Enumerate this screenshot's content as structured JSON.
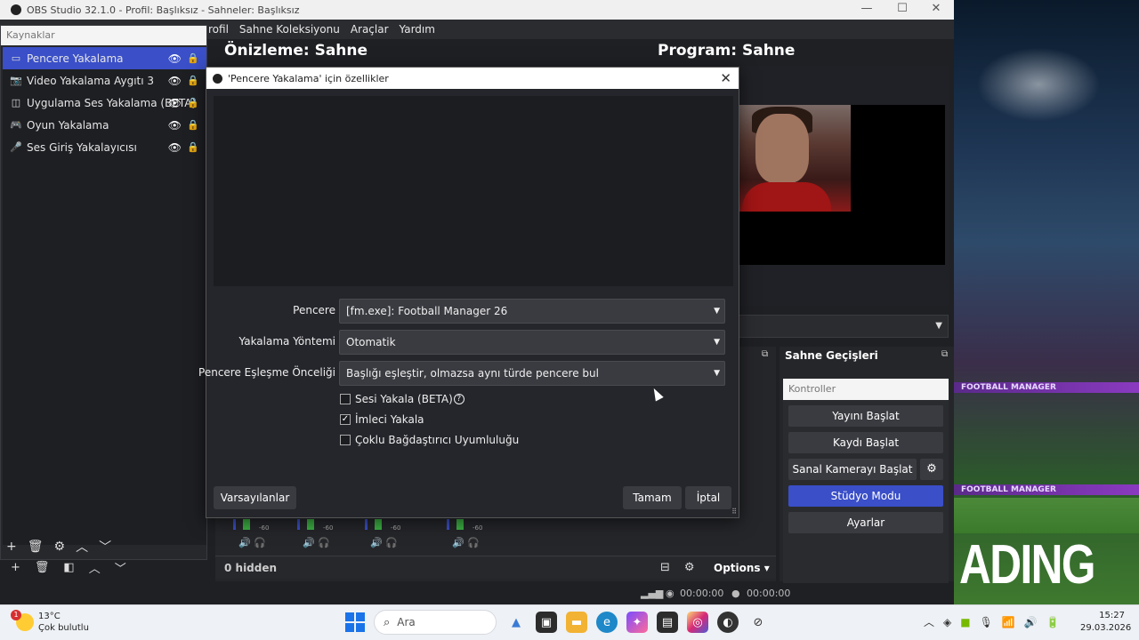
{
  "window": {
    "title": "OBS Studio 32.1.0 - Profil: Başlıksız - Sahneler: Başlıksız",
    "minimize": "—",
    "maximize": "☐",
    "close": "✕"
  },
  "menu": [
    "rofil",
    "Sahne Koleksiyonu",
    "Araçlar",
    "Yardım"
  ],
  "preview_label": "Önizleme: Sahne",
  "program_label": "Program: Sahne",
  "sources": {
    "dock_title": "Kaynaklar",
    "items": [
      {
        "label": "Pencere Yakalama",
        "icon": "window-icon"
      },
      {
        "label": "Video Yakalama Aygıtı 3",
        "icon": "camera-icon"
      },
      {
        "label": "Uygulama Ses Yakalama (BETA)",
        "icon": "app-audio-icon"
      },
      {
        "label": "Oyun Yakalama",
        "icon": "gamepad-icon"
      },
      {
        "label": "Ses Giriş Yakalayıcısı",
        "icon": "microphone-icon"
      }
    ],
    "selected_index": 0
  },
  "mixer": {
    "db_label": "-60",
    "hidden_label": "0 hidden",
    "options_label": "Options"
  },
  "transitions": {
    "title": "Sahne Geçişleri"
  },
  "controls": {
    "title": "Kontroller",
    "start_stream": "Yayını Başlat",
    "start_record": "Kaydı Başlat",
    "start_virtualcam": "Sanal Kamerayı Başlat",
    "studio_mode": "Stüdyo Modu",
    "settings": "Ayarlar"
  },
  "status": {
    "stream_time": "00:00:00",
    "record_time": "00:00:00"
  },
  "dialog": {
    "title": "'Pencere Yakalama' için özellikler",
    "window_label": "Pencere",
    "window_value": "[fm.exe]: Football Manager 26",
    "method_label": "Yakalama Yöntemi",
    "method_value": "Otomatik",
    "priority_label": "Pencere Eşleşme Önceliği",
    "priority_value": "Başlığı eşleştir, olmazsa aynı türde pencere bul",
    "capture_audio": {
      "label": "Sesi Yakala (BETA)",
      "checked": false
    },
    "capture_cursor": {
      "label": "İmleci Yakala",
      "checked": true
    },
    "multi_adapter": {
      "label": "Çoklu Bağdaştırıcı Uyumluluğu",
      "checked": false
    },
    "defaults_button": "Varsayılanlar",
    "ok_button": "Tamam",
    "cancel_button": "İptal"
  },
  "wallpaper": {
    "banner_text": "FOOTBALL MANAGER",
    "big_text": "ADING"
  },
  "taskbar": {
    "weather_temp": "13°C",
    "weather_desc": "Çok bulutlu",
    "weather_badge": "1",
    "search_placeholder": "Ara",
    "time": "15:27",
    "date": "29.03.2026"
  },
  "colors": {
    "accent": "#3a4fc8",
    "panel": "#25262a",
    "background": "#1f2024"
  }
}
